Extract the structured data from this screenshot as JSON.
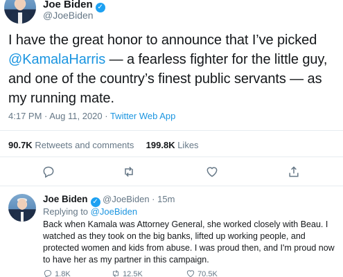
{
  "main_tweet": {
    "author_name": "Joe Biden",
    "handle": "@JoeBiden",
    "text_before": "I have the great honor to announce that I’ve picked ",
    "mention": "@KamalaHarris",
    "text_after": " — a fearless fighter for the little guy, and one of the country’s finest public servants — as my running mate.",
    "timestamp": "4:17 PM · Aug 11, 2020 · ",
    "source": "Twitter Web App",
    "retweets_count": "90.7K",
    "retweets_label": "Retweets and comments",
    "likes_count": "199.8K",
    "likes_label": "Likes"
  },
  "reply_tweet": {
    "author_name": "Joe Biden",
    "handle": "@JoeBiden",
    "time_ago": "· 15m",
    "replying_prefix": "Replying to ",
    "replying_to": "@JoeBiden",
    "text": "Back when Kamala was Attorney General, she worked closely with Beau. I watched as they took on the big banks, lifted up working people, and protected women and kids from abuse. I was proud then, and I'm proud now to have her as my partner in this campaign.",
    "reply_count": "1.8K",
    "retweet_count": "12.5K",
    "like_count": "70.5K"
  },
  "colors": {
    "accent": "#1da1f2",
    "link": "#1b95e0",
    "muted": "#657786",
    "divider": "#e6ecf0"
  },
  "icons": [
    "verified-icon",
    "reply-icon",
    "retweet-icon",
    "like-icon",
    "share-icon"
  ]
}
